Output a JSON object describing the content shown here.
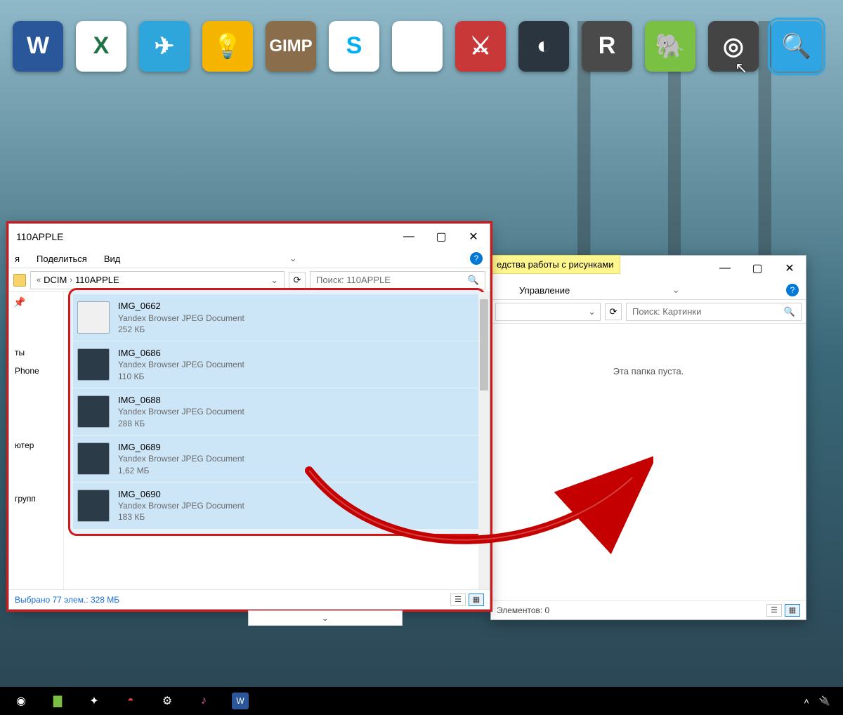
{
  "dock": [
    {
      "name": "word-icon",
      "label": "W"
    },
    {
      "name": "excel-icon",
      "label": "X"
    },
    {
      "name": "telegram-icon",
      "label": "✈"
    },
    {
      "name": "keep-icon",
      "label": "💡"
    },
    {
      "name": "gimp-icon",
      "label": "GIMP"
    },
    {
      "name": "skype-icon",
      "label": "S"
    },
    {
      "name": "chrome-icon",
      "label": "◉"
    },
    {
      "name": "game-icon",
      "label": "⚔"
    },
    {
      "name": "steam-icon",
      "label": "◐"
    },
    {
      "name": "r-icon",
      "label": "R"
    },
    {
      "name": "evernote-icon",
      "label": "🐘"
    },
    {
      "name": "dark-app-icon",
      "label": "◎"
    },
    {
      "name": "search-app-icon",
      "label": "🔍"
    }
  ],
  "window1": {
    "title": "110APPLE",
    "tabs": {
      "t1": "я",
      "share": "Поделиться",
      "view": "Вид"
    },
    "breadcrumb": {
      "sep": "«",
      "p1": "DCIM",
      "p2": "110APPLE"
    },
    "search_placeholder": "Поиск: 110APPLE",
    "sidebar": {
      "item1": "ты",
      "item2": "Phone",
      "item3": "ютер",
      "item4": "групп"
    },
    "files": [
      {
        "name": "IMG_0662",
        "type": "Yandex Browser JPEG Document",
        "size": "252 КБ",
        "light": true
      },
      {
        "name": "IMG_0686",
        "type": "Yandex Browser JPEG Document",
        "size": "110 КБ",
        "light": false
      },
      {
        "name": "IMG_0688",
        "type": "Yandex Browser JPEG Document",
        "size": "288 КБ",
        "light": false
      },
      {
        "name": "IMG_0689",
        "type": "Yandex Browser JPEG Document",
        "size": "1,62 МБ",
        "light": false
      },
      {
        "name": "IMG_0690",
        "type": "Yandex Browser JPEG Document",
        "size": "183 КБ",
        "light": false
      }
    ],
    "status": "Выбрано 77 элем.: 328 МБ"
  },
  "window2": {
    "tools_tab": "едства работы с рисунками",
    "manage_tab": "Управление",
    "search_placeholder": "Поиск: Картинки",
    "empty_msg": "Эта папка пуста.",
    "status": "Элементов: 0"
  }
}
